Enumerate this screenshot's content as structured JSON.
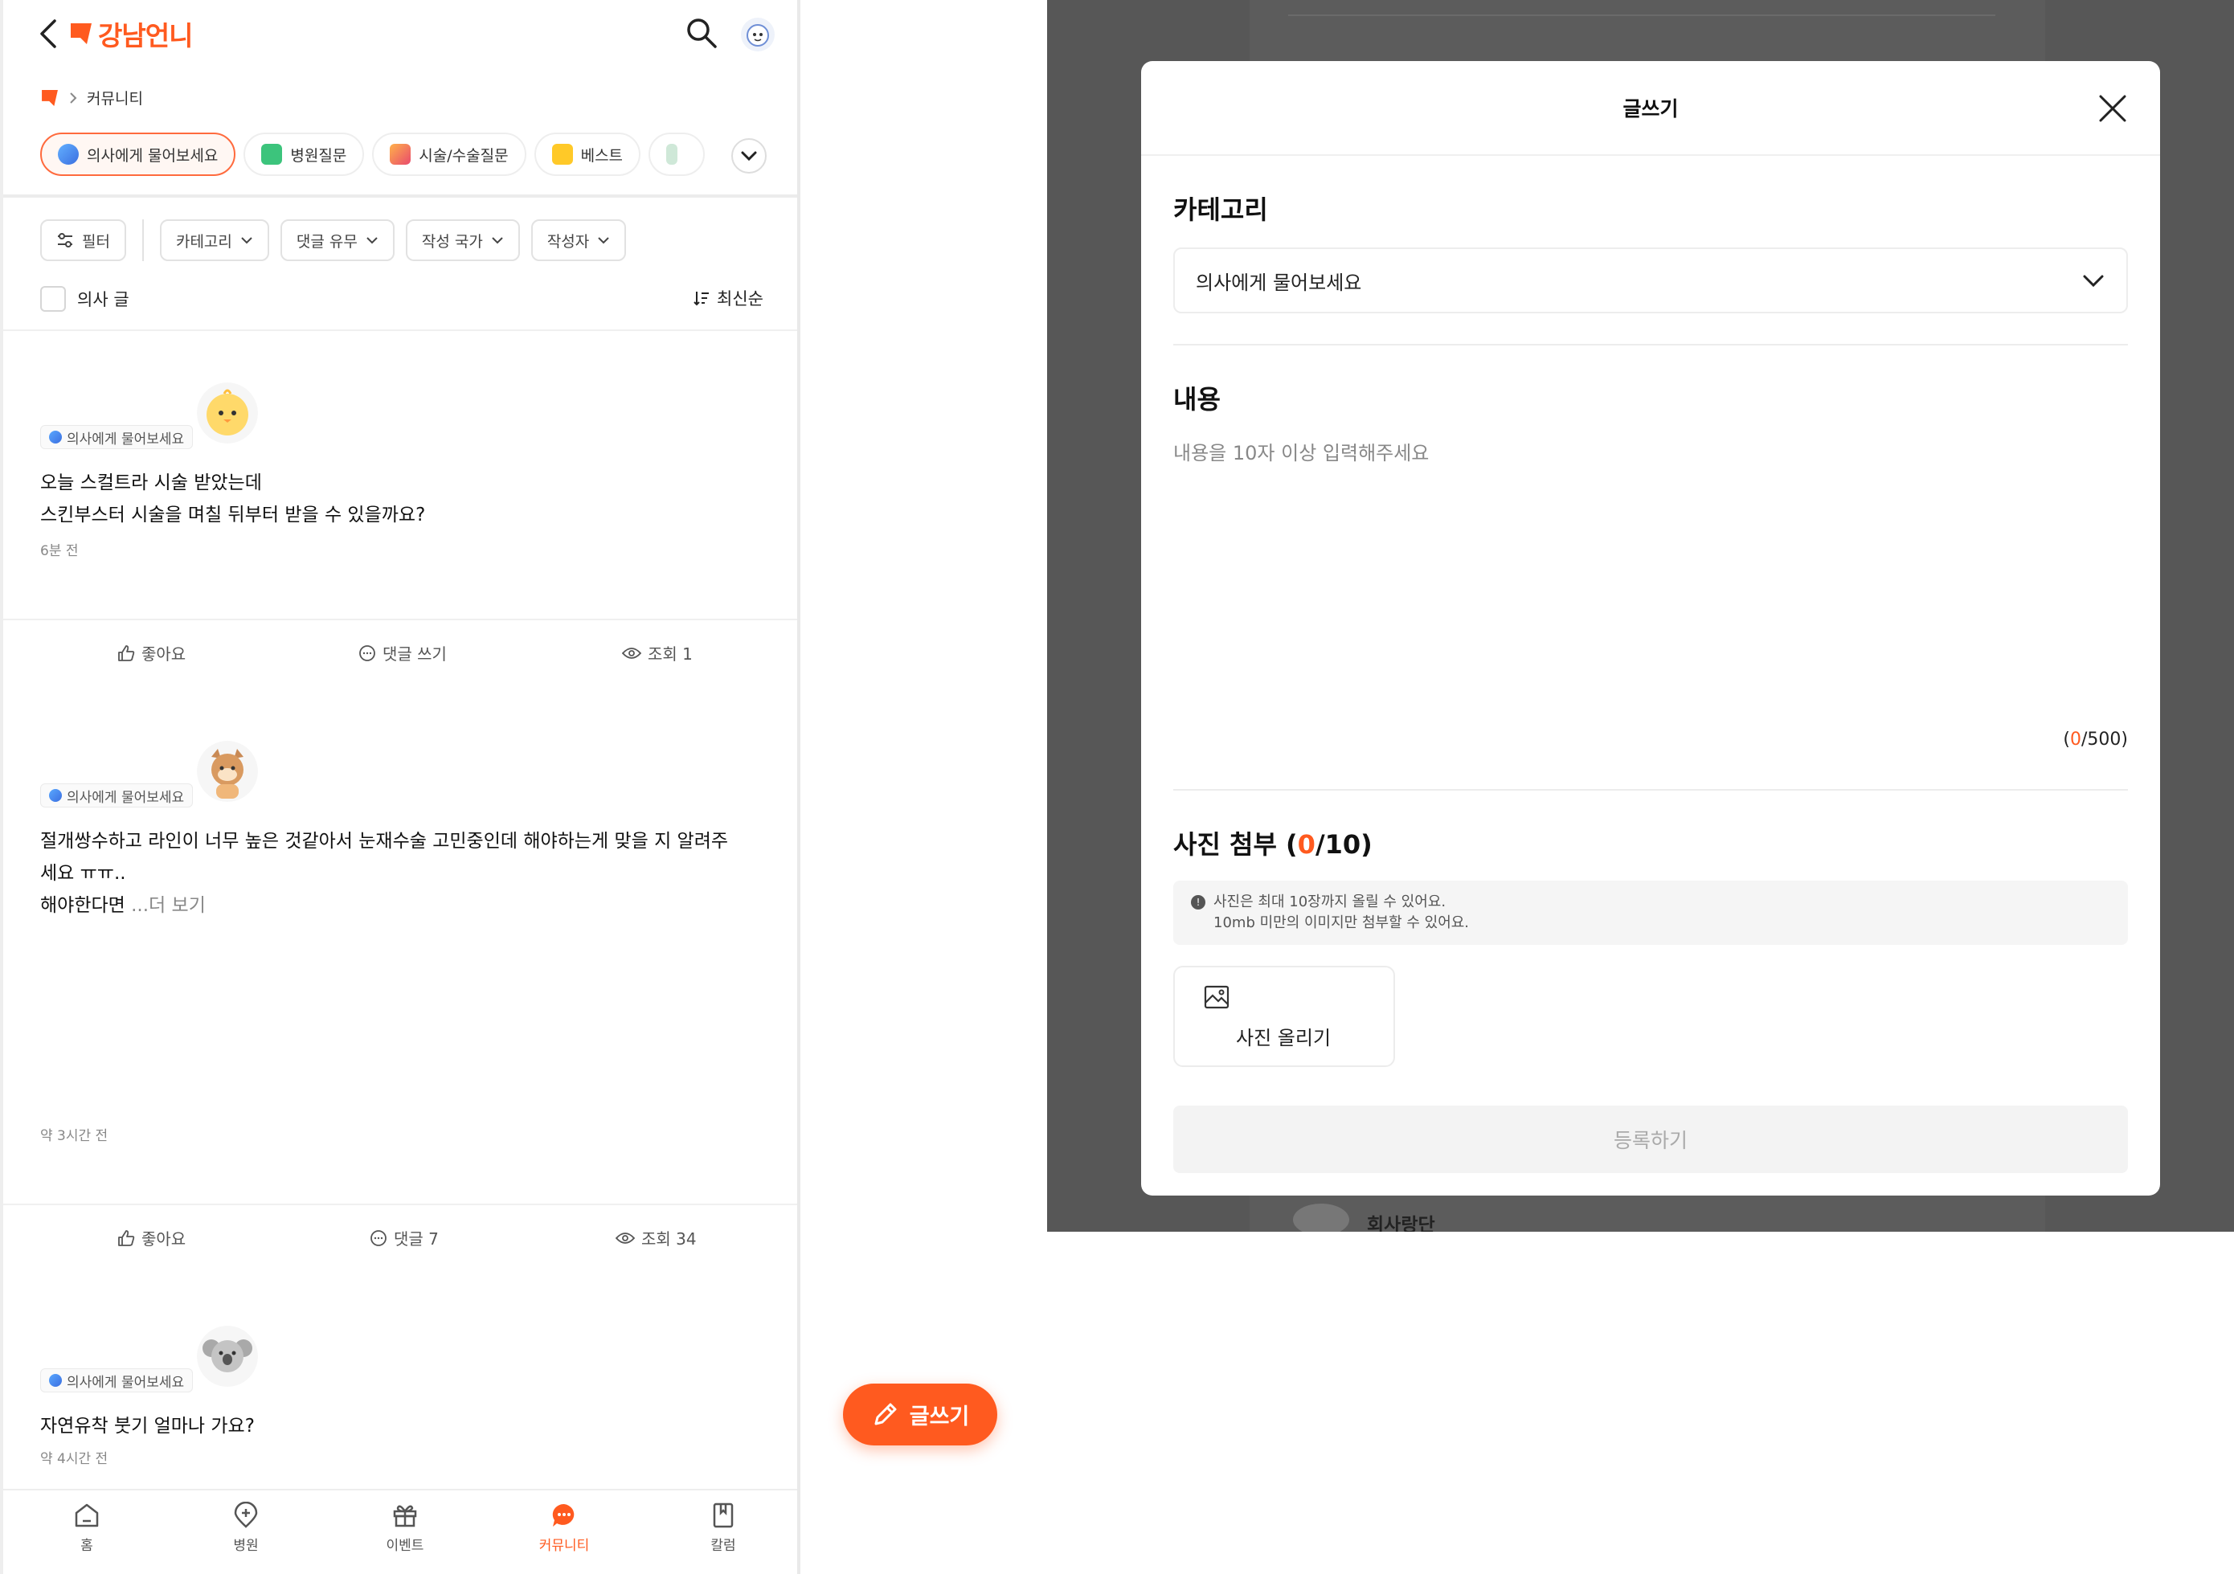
{
  "app": {
    "brand": "강남언니",
    "accent": "#ff5a1f"
  },
  "breadcrumb": {
    "current": "커뮤니티"
  },
  "chips": [
    {
      "label": "의사에게 물어보세요",
      "active": true
    },
    {
      "label": "병원질문"
    },
    {
      "label": "시술/수술질문"
    },
    {
      "label": "베스트"
    }
  ],
  "filters": {
    "filter_label": "필터",
    "category": "카테고리",
    "comment": "댓글 유무",
    "country": "작성 국가",
    "author": "작성자"
  },
  "doctor_only_label": "의사 글",
  "sort_label": "최신순",
  "posts": [
    {
      "tag": "의사에게 물어보세요",
      "text1": "오늘 스컬트라 시술 받았는데",
      "text2": "스킨부스터 시술을 며칠 뒤부터 받을 수 있을까요?",
      "time": "6분 전",
      "like": "좋아요",
      "comment": "댓글 쓰기",
      "views": "조회 1"
    },
    {
      "tag": "의사에게 물어보세요",
      "text1": "절개쌍수하고 라인이 너무 높은 것같아서 눈재수술 고민중인데 해야하는게 맞을 지 알려주",
      "text2": "세요 ㅠㅠ..",
      "text3": "해야한다면",
      "more": " ...더 보기",
      "time": "약 3시간 전",
      "like": "좋아요",
      "comment": "댓글 7",
      "views": "조회 34"
    },
    {
      "tag": "의사에게 물어보세요",
      "text1": "자연유착 붓기 얼마나 가요?",
      "time": "약 4시간 전"
    }
  ],
  "bottom_nav": [
    {
      "label": "홈"
    },
    {
      "label": "병원"
    },
    {
      "label": "이벤트"
    },
    {
      "label": "커뮤니티",
      "active": true
    },
    {
      "label": "칼럼"
    }
  ],
  "fab": {
    "label": "글쓰기"
  },
  "modal": {
    "title": "글쓰기",
    "category_title": "카테고리",
    "category_value": "의사에게 물어보세요",
    "content_title": "내용",
    "content_placeholder": "내용을 10자 이상 입력해주세요",
    "counter_open": "(",
    "counter_current": "0",
    "counter_rest": "/500)",
    "photo_title_pre": "사진 첨부 (",
    "photo_count": "0",
    "photo_title_post": "/10)",
    "notice_line1": "사진은 최대 10장까지 올릴 수 있어요.",
    "notice_line2": "10mb 미만의 이미지만 첨부할 수 있어요.",
    "upload_label": "사진 올리기",
    "submit_label": "등록하기"
  },
  "background": {
    "partial_text": "회사랑단"
  }
}
